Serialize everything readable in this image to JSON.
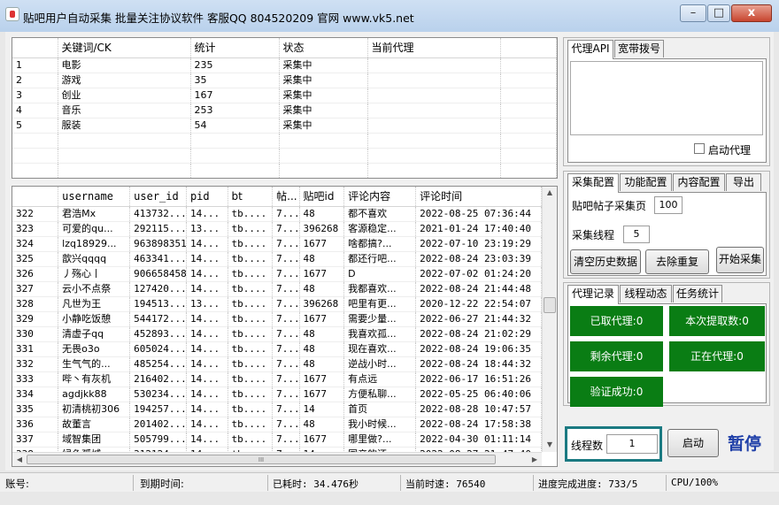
{
  "window": {
    "title": "贴吧用户自动采集 批量关注协议软件 客服QQ 804520209 官网 www.vk5.net",
    "minimize": "–",
    "maximize": "□",
    "close": "x"
  },
  "keyword_table": {
    "headers": [
      "",
      "关键词/CK",
      "统计",
      "状态",
      "当前代理"
    ],
    "rows": [
      [
        "1",
        "电影",
        "235",
        "采集中",
        ""
      ],
      [
        "2",
        "游戏",
        "35",
        "采集中",
        ""
      ],
      [
        "3",
        "创业",
        "167",
        "采集中",
        ""
      ],
      [
        "4",
        "音乐",
        "253",
        "采集中",
        ""
      ],
      [
        "5",
        "服装",
        "54",
        "采集中",
        ""
      ]
    ]
  },
  "user_table": {
    "headers": [
      "",
      "username",
      "user_id",
      "pid",
      "bt",
      "帖...",
      "贴吧id",
      "评论内容",
      "评论时间"
    ],
    "rows": [
      [
        "322",
        "君浩Mx",
        "413732...",
        "14...",
        "tb....",
        "7...",
        "48",
        "都不喜欢",
        "2022-08-25 07:36:44"
      ],
      [
        "323",
        "可爱的qu...",
        "292115...",
        "13...",
        "tb....",
        "7...",
        "396268",
        "客源稳定...",
        "2021-01-24 17:40:40"
      ],
      [
        "324",
        "lzq18929...",
        "963898351",
        "14...",
        "tb....",
        "7...",
        "1677",
        "啥都搞?...",
        "2022-07-10 23:19:29"
      ],
      [
        "325",
        "歆兴qqqq",
        "463341...",
        "14...",
        "tb....",
        "7...",
        "48",
        "都还行吧...",
        "2022-08-24 23:03:39"
      ],
      [
        "326",
        "丿殇心丨",
        "906658458",
        "14...",
        "tb....",
        "7...",
        "1677",
        "D",
        "2022-07-02 01:24:20"
      ],
      [
        "327",
        "云小不点祭",
        "127420...",
        "14...",
        "tb....",
        "7...",
        "48",
        "我都喜欢...",
        "2022-08-24 21:44:48"
      ],
      [
        "328",
        "凡世为王",
        "194513...",
        "13...",
        "tb....",
        "7...",
        "396268",
        "吧里有更...",
        "2020-12-22 22:54:07"
      ],
      [
        "329",
        "小静吃饭憩",
        "544172...",
        "14...",
        "tb....",
        "7...",
        "1677",
        "需要少量...",
        "2022-06-27 21:44:32"
      ],
      [
        "330",
        "清虚子qq",
        "452893...",
        "14...",
        "tb....",
        "7...",
        "48",
        "我喜欢孤...",
        "2022-08-24 21:02:29"
      ],
      [
        "331",
        "无畏o3o",
        "605024...",
        "14...",
        "tb....",
        "7...",
        "48",
        "现在喜欢...",
        "2022-08-24 19:06:35"
      ],
      [
        "332",
        "生气气的...",
        "485254...",
        "14...",
        "tb....",
        "7...",
        "48",
        "逆战小时...",
        "2022-08-24 18:44:32"
      ],
      [
        "333",
        "哔丶有灰机",
        "216402...",
        "14...",
        "tb....",
        "7...",
        "1677",
        "有点远",
        "2022-06-17 16:51:26"
      ],
      [
        "334",
        "agdjkk88",
        "530234...",
        "14...",
        "tb....",
        "7...",
        "1677",
        "方便私聊...",
        "2022-05-25 06:40:06"
      ],
      [
        "335",
        "初清桃初306",
        "194257...",
        "14...",
        "tb....",
        "7...",
        "14",
        "首页",
        "2022-08-28 10:47:57"
      ],
      [
        "336",
        "故董言",
        "201402...",
        "14...",
        "tb....",
        "7...",
        "48",
        "我小时候...",
        "2022-08-24 17:58:38"
      ],
      [
        "337",
        "域智集团",
        "505799...",
        "14...",
        "tb....",
        "7...",
        "1677",
        "哪里做?...",
        "2022-04-30 01:11:14"
      ],
      [
        "338",
        "绿色孤城",
        "312124...",
        "14...",
        "tb....",
        "7...",
        "14",
        "国产的还...",
        "2022-08-27 21:47:40"
      ],
      [
        "339",
        "",
        "",
        "",
        "",
        "",
        "",
        "",
        ""
      ]
    ],
    "hscroll_thumb": "III"
  },
  "proxy_panel": {
    "tabs": [
      "代理API",
      "宽带拨号"
    ],
    "enable_proxy": "启动代理"
  },
  "config_panel": {
    "tabs": [
      "采集配置",
      "功能配置",
      "内容配置",
      "导出"
    ],
    "pages_label": "贴吧帖子采集页",
    "pages_value": "100",
    "threads_label": "采集线程",
    "threads_value": "5",
    "clear_btn": "清空历史数据",
    "dedupe_btn": "去除重复",
    "start_btn": "开始采集"
  },
  "stats_panel": {
    "tabs": [
      "代理记录",
      "线程动态",
      "任务统计"
    ],
    "boxes": [
      "已取代理:0",
      "本次提取数:0",
      "剩余代理:0",
      "正在代理:0",
      "验证成功:0"
    ]
  },
  "control": {
    "thread_label": "线程数",
    "thread_value": "1",
    "start_btn": "启动",
    "pause_btn": "暂停"
  },
  "statusbar": {
    "account": "账号:",
    "expire": "到期时间:",
    "elapsed": "已耗时: 34.476秒",
    "speed": "当前时速: 76540",
    "progress": "进度完成进度: 733/5",
    "cpu": "CPU/100%"
  },
  "colors": {
    "green": "#0a7d14",
    "teal": "#1b7a82",
    "pause": "#2040a8"
  }
}
